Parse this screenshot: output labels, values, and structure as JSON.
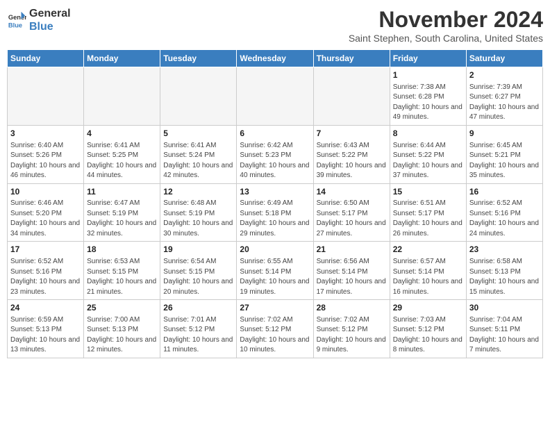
{
  "header": {
    "logo_line1": "General",
    "logo_line2": "Blue",
    "month": "November 2024",
    "location": "Saint Stephen, South Carolina, United States"
  },
  "weekdays": [
    "Sunday",
    "Monday",
    "Tuesday",
    "Wednesday",
    "Thursday",
    "Friday",
    "Saturday"
  ],
  "weeks": [
    [
      {
        "day": "",
        "info": ""
      },
      {
        "day": "",
        "info": ""
      },
      {
        "day": "",
        "info": ""
      },
      {
        "day": "",
        "info": ""
      },
      {
        "day": "",
        "info": ""
      },
      {
        "day": "1",
        "info": "Sunrise: 7:38 AM\nSunset: 6:28 PM\nDaylight: 10 hours\nand 49 minutes."
      },
      {
        "day": "2",
        "info": "Sunrise: 7:39 AM\nSunset: 6:27 PM\nDaylight: 10 hours\nand 47 minutes."
      }
    ],
    [
      {
        "day": "3",
        "info": "Sunrise: 6:40 AM\nSunset: 5:26 PM\nDaylight: 10 hours\nand 46 minutes."
      },
      {
        "day": "4",
        "info": "Sunrise: 6:41 AM\nSunset: 5:25 PM\nDaylight: 10 hours\nand 44 minutes."
      },
      {
        "day": "5",
        "info": "Sunrise: 6:41 AM\nSunset: 5:24 PM\nDaylight: 10 hours\nand 42 minutes."
      },
      {
        "day": "6",
        "info": "Sunrise: 6:42 AM\nSunset: 5:23 PM\nDaylight: 10 hours\nand 40 minutes."
      },
      {
        "day": "7",
        "info": "Sunrise: 6:43 AM\nSunset: 5:22 PM\nDaylight: 10 hours\nand 39 minutes."
      },
      {
        "day": "8",
        "info": "Sunrise: 6:44 AM\nSunset: 5:22 PM\nDaylight: 10 hours\nand 37 minutes."
      },
      {
        "day": "9",
        "info": "Sunrise: 6:45 AM\nSunset: 5:21 PM\nDaylight: 10 hours\nand 35 minutes."
      }
    ],
    [
      {
        "day": "10",
        "info": "Sunrise: 6:46 AM\nSunset: 5:20 PM\nDaylight: 10 hours\nand 34 minutes."
      },
      {
        "day": "11",
        "info": "Sunrise: 6:47 AM\nSunset: 5:19 PM\nDaylight: 10 hours\nand 32 minutes."
      },
      {
        "day": "12",
        "info": "Sunrise: 6:48 AM\nSunset: 5:19 PM\nDaylight: 10 hours\nand 30 minutes."
      },
      {
        "day": "13",
        "info": "Sunrise: 6:49 AM\nSunset: 5:18 PM\nDaylight: 10 hours\nand 29 minutes."
      },
      {
        "day": "14",
        "info": "Sunrise: 6:50 AM\nSunset: 5:17 PM\nDaylight: 10 hours\nand 27 minutes."
      },
      {
        "day": "15",
        "info": "Sunrise: 6:51 AM\nSunset: 5:17 PM\nDaylight: 10 hours\nand 26 minutes."
      },
      {
        "day": "16",
        "info": "Sunrise: 6:52 AM\nSunset: 5:16 PM\nDaylight: 10 hours\nand 24 minutes."
      }
    ],
    [
      {
        "day": "17",
        "info": "Sunrise: 6:52 AM\nSunset: 5:16 PM\nDaylight: 10 hours\nand 23 minutes."
      },
      {
        "day": "18",
        "info": "Sunrise: 6:53 AM\nSunset: 5:15 PM\nDaylight: 10 hours\nand 21 minutes."
      },
      {
        "day": "19",
        "info": "Sunrise: 6:54 AM\nSunset: 5:15 PM\nDaylight: 10 hours\nand 20 minutes."
      },
      {
        "day": "20",
        "info": "Sunrise: 6:55 AM\nSunset: 5:14 PM\nDaylight: 10 hours\nand 19 minutes."
      },
      {
        "day": "21",
        "info": "Sunrise: 6:56 AM\nSunset: 5:14 PM\nDaylight: 10 hours\nand 17 minutes."
      },
      {
        "day": "22",
        "info": "Sunrise: 6:57 AM\nSunset: 5:14 PM\nDaylight: 10 hours\nand 16 minutes."
      },
      {
        "day": "23",
        "info": "Sunrise: 6:58 AM\nSunset: 5:13 PM\nDaylight: 10 hours\nand 15 minutes."
      }
    ],
    [
      {
        "day": "24",
        "info": "Sunrise: 6:59 AM\nSunset: 5:13 PM\nDaylight: 10 hours\nand 13 minutes."
      },
      {
        "day": "25",
        "info": "Sunrise: 7:00 AM\nSunset: 5:13 PM\nDaylight: 10 hours\nand 12 minutes."
      },
      {
        "day": "26",
        "info": "Sunrise: 7:01 AM\nSunset: 5:12 PM\nDaylight: 10 hours\nand 11 minutes."
      },
      {
        "day": "27",
        "info": "Sunrise: 7:02 AM\nSunset: 5:12 PM\nDaylight: 10 hours\nand 10 minutes."
      },
      {
        "day": "28",
        "info": "Sunrise: 7:02 AM\nSunset: 5:12 PM\nDaylight: 10 hours\nand 9 minutes."
      },
      {
        "day": "29",
        "info": "Sunrise: 7:03 AM\nSunset: 5:12 PM\nDaylight: 10 hours\nand 8 minutes."
      },
      {
        "day": "30",
        "info": "Sunrise: 7:04 AM\nSunset: 5:11 PM\nDaylight: 10 hours\nand 7 minutes."
      }
    ]
  ]
}
